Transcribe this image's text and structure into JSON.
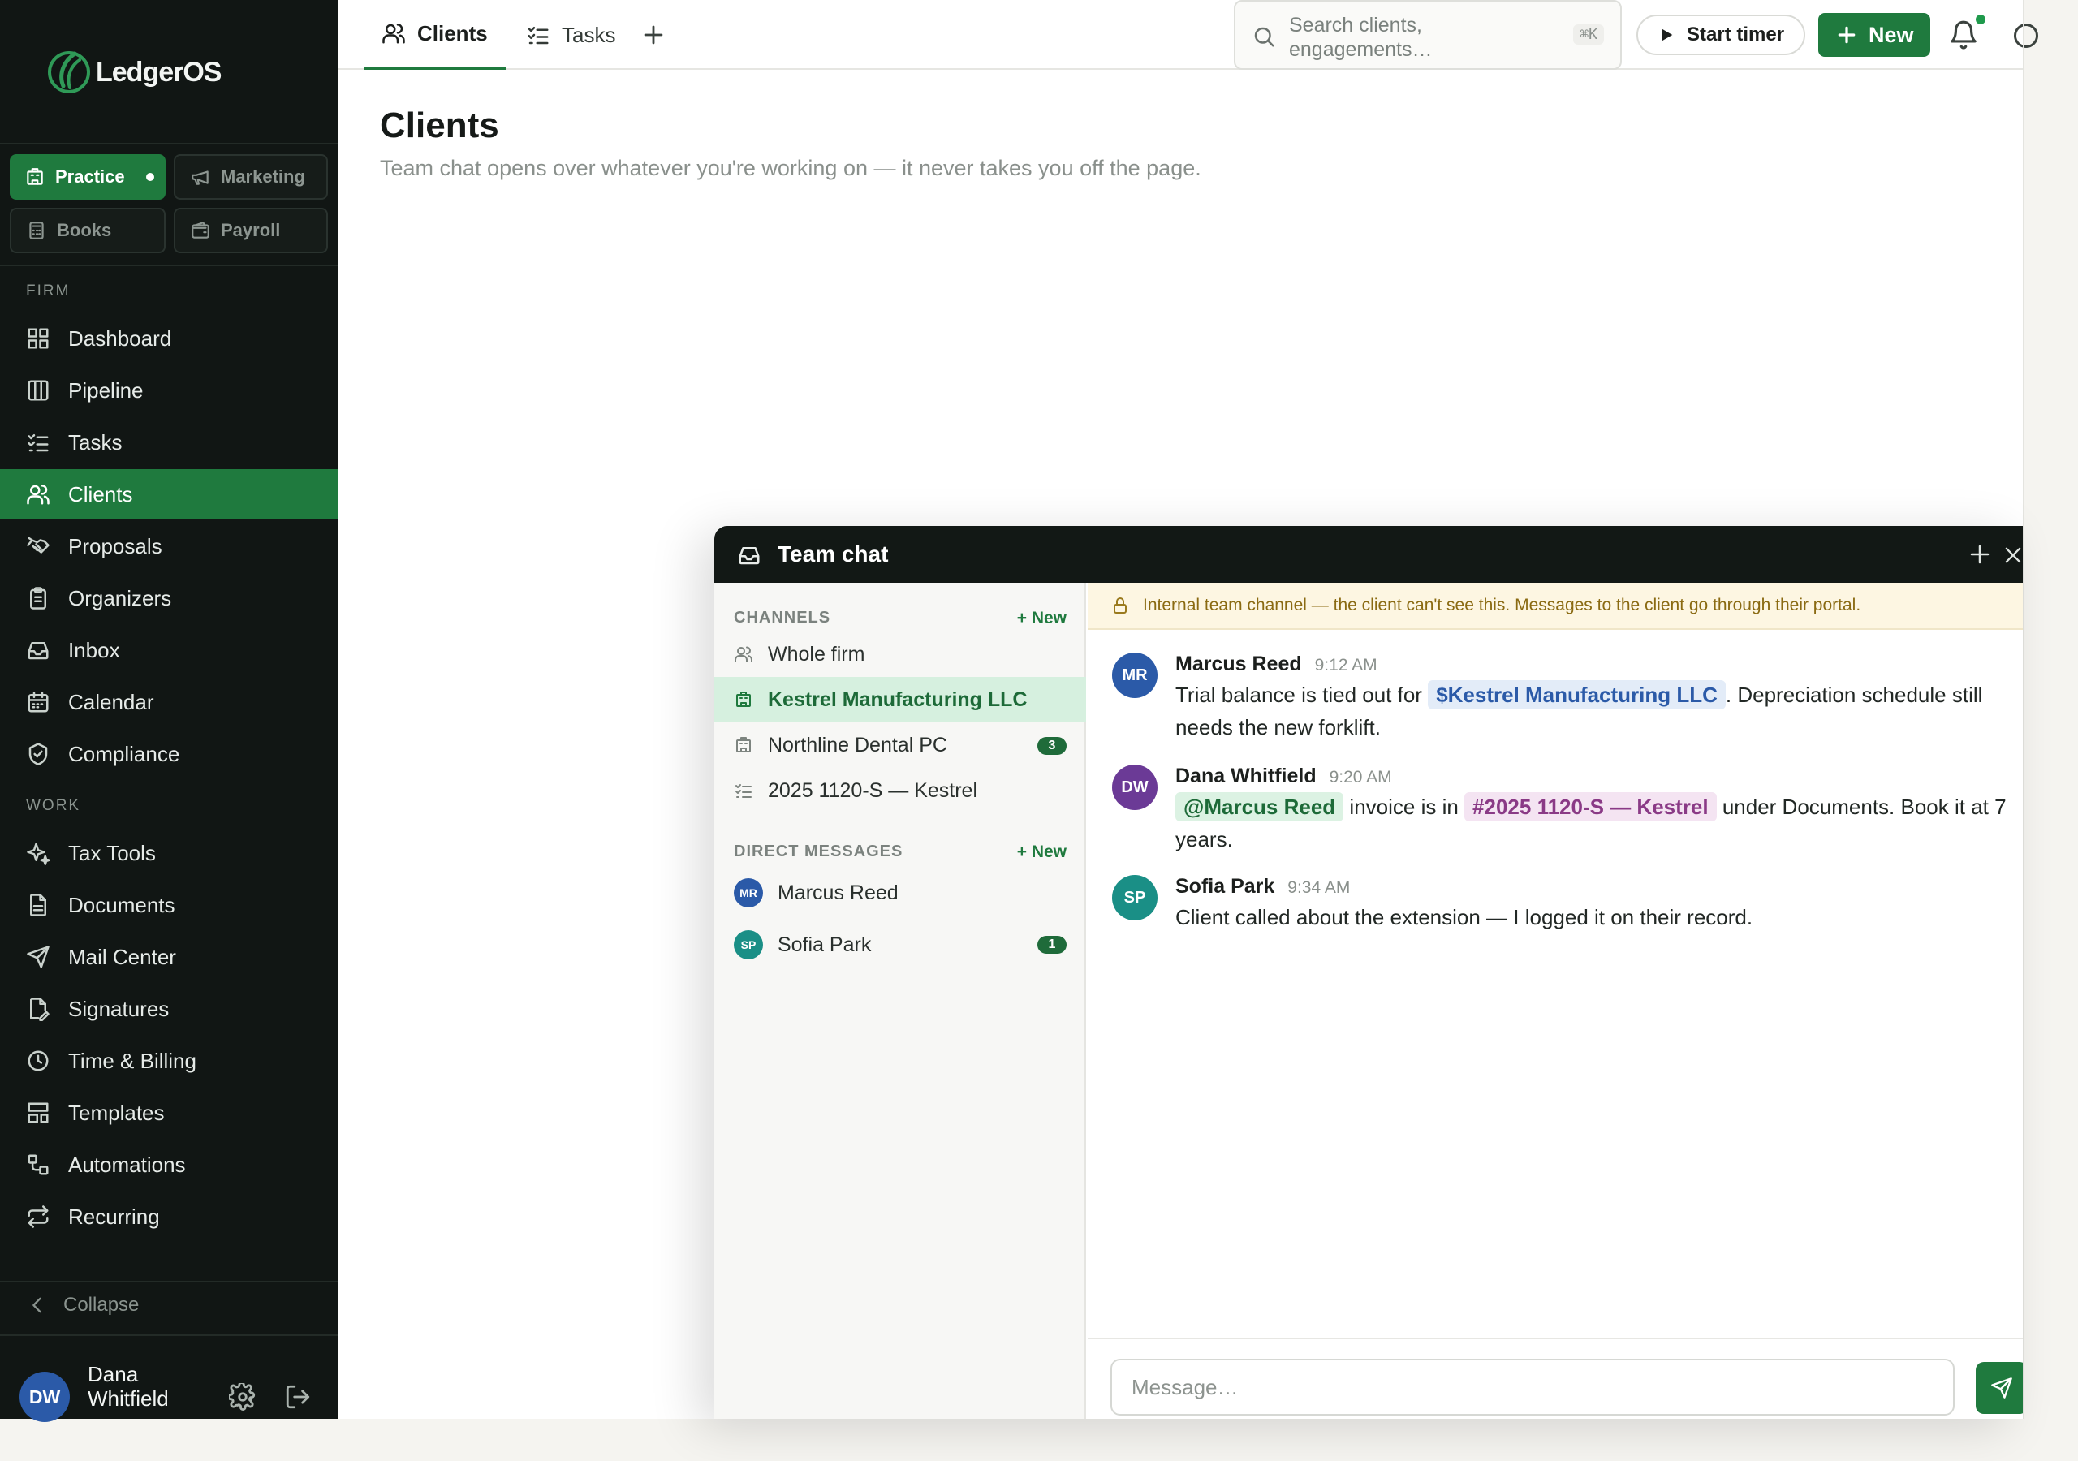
{
  "brand": {
    "name": "LedgerOS"
  },
  "workspaces": [
    {
      "label": "Practice",
      "active": true
    },
    {
      "label": "Marketing",
      "active": false
    },
    {
      "label": "Books",
      "active": false
    },
    {
      "label": "Payroll",
      "active": false
    }
  ],
  "sidebar": {
    "firm_label": "FIRM",
    "work_label": "WORK",
    "firm_items": [
      {
        "label": "Dashboard",
        "icon": "grid-icon"
      },
      {
        "label": "Pipeline",
        "icon": "columns-icon"
      },
      {
        "label": "Tasks",
        "icon": "checklist-icon"
      },
      {
        "label": "Clients",
        "icon": "users-icon",
        "active": true
      },
      {
        "label": "Proposals",
        "icon": "handshake-icon"
      },
      {
        "label": "Organizers",
        "icon": "clipboard-icon"
      },
      {
        "label": "Inbox",
        "icon": "inbox-icon"
      },
      {
        "label": "Calendar",
        "icon": "calendar-icon"
      },
      {
        "label": "Compliance",
        "icon": "shield-check-icon"
      }
    ],
    "work_items": [
      {
        "label": "Tax Tools",
        "icon": "sparkles-icon"
      },
      {
        "label": "Documents",
        "icon": "document-icon"
      },
      {
        "label": "Mail Center",
        "icon": "send-icon"
      },
      {
        "label": "Signatures",
        "icon": "signature-icon"
      },
      {
        "label": "Time & Billing",
        "icon": "clock-icon"
      },
      {
        "label": "Templates",
        "icon": "layout-icon"
      },
      {
        "label": "Automations",
        "icon": "workflow-icon"
      },
      {
        "label": "Recurring",
        "icon": "repeat-icon"
      }
    ],
    "collapse_label": "Collapse"
  },
  "user": {
    "initials": "DW",
    "name": "Dana Whitfield"
  },
  "topbar": {
    "tabs": [
      {
        "label": "Clients",
        "active": true
      },
      {
        "label": "Tasks",
        "active": false
      }
    ],
    "search_placeholder": "Search clients, engagements…",
    "search_shortcut": "⌘K",
    "start_timer_label": "Start timer",
    "new_label": "New"
  },
  "page": {
    "title": "Clients",
    "subtitle": "Team chat opens over whatever you're working on — it never takes you off the page."
  },
  "chat": {
    "title": "Team chat",
    "channels_label": "CHANNELS",
    "dms_label": "DIRECT MESSAGES",
    "new_label": "+ New",
    "channels": [
      {
        "label": "Whole firm",
        "icon": "users-icon"
      },
      {
        "label": "Kestrel Manufacturing LLC",
        "icon": "building-icon",
        "active": true
      },
      {
        "label": "Northline Dental PC",
        "icon": "building-icon",
        "unread": "3"
      },
      {
        "label": "2025 1120-S — Kestrel",
        "icon": "checklist-icon"
      }
    ],
    "dms": [
      {
        "initials": "MR",
        "name": "Marcus Reed",
        "color": "#2b5aa8"
      },
      {
        "initials": "SP",
        "name": "Sofia Park",
        "color": "#1a8f86",
        "unread": "1"
      }
    ],
    "notice": "Internal team channel — the client can't see this. Messages to the client go through their portal.",
    "messages": [
      {
        "initials": "MR",
        "author": "Marcus Reed",
        "time": "9:12 AM",
        "color": "#2b5aa8",
        "pre": "Trial balance is tied out for ",
        "mention": "$Kestrel Manufacturing LLC",
        "post": ". Depreciation schedule still needs the new forklift."
      },
      {
        "initials": "DW",
        "author": "Dana Whitfield",
        "time": "9:20 AM",
        "color": "#6b3a96",
        "mention_user": "@Marcus Reed",
        "mid": " invoice is in ",
        "mention_eng": "#2025 1120-S — Kestrel",
        "post": " under Documents. Book it at 7 years."
      },
      {
        "initials": "SP",
        "author": "Sofia Park",
        "time": "9:34 AM",
        "color": "#1a8f86",
        "text": "Client called about the extension — I logged it on their record."
      }
    ],
    "composer_placeholder": "Message…"
  }
}
